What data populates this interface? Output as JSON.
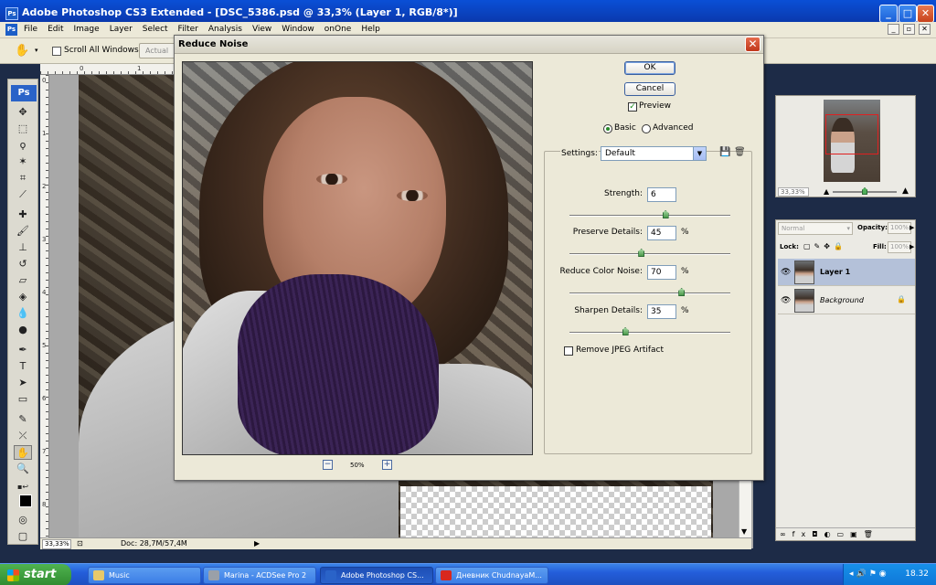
{
  "window": {
    "title": "Adobe Photoshop CS3 Extended - [DSC_5386.psd @ 33,3% (Layer 1, RGB/8*)]",
    "app_icon": "Ps"
  },
  "menu": {
    "items": [
      "File",
      "Edit",
      "Image",
      "Layer",
      "Select",
      "Filter",
      "Analysis",
      "View",
      "Window",
      "onOne",
      "Help"
    ]
  },
  "options_bar": {
    "scroll_all_windows": "Scroll All Windows",
    "actual_button": "Actual"
  },
  "toolbox": {
    "logo": "Ps"
  },
  "rulers": {
    "h_labels": [
      "0",
      "1"
    ],
    "v_labels": [
      "0",
      "1",
      "2",
      "3",
      "4",
      "5",
      "6",
      "7",
      "8"
    ]
  },
  "document": {
    "zoom": "33,33%",
    "doc_size": "Doc: 28,7M/57,4M"
  },
  "navigator": {
    "zoom": "33,33%"
  },
  "layers": {
    "blend_mode": "Normal",
    "opacity_label": "Opacity:",
    "opacity_value": "100%",
    "lock_label": "Lock:",
    "fill_label": "Fill:",
    "fill_value": "100%",
    "items": [
      {
        "name": "Layer 1",
        "selected": true
      },
      {
        "name": "Background",
        "selected": false
      }
    ]
  },
  "dialog": {
    "title": "Reduce Noise",
    "ok": "OK",
    "cancel": "Cancel",
    "preview_label": "Preview",
    "preview_checked": true,
    "mode_basic": "Basic",
    "mode_advanced": "Advanced",
    "mode_selected": "Basic",
    "settings_label": "Settings:",
    "settings_value": "Default",
    "preview_zoom": "50%",
    "sliders": [
      {
        "label": "Strength:",
        "value": "6",
        "unit": "",
        "fraction": 0.6
      },
      {
        "label": "Preserve Details:",
        "value": "45",
        "unit": "%",
        "fraction": 0.45
      },
      {
        "label": "Reduce Color Noise:",
        "value": "70",
        "unit": "%",
        "fraction": 0.7
      },
      {
        "label": "Sharpen Details:",
        "value": "35",
        "unit": "%",
        "fraction": 0.35
      }
    ],
    "remove_jpeg_label": "Remove JPEG Artifact",
    "remove_jpeg_checked": false
  },
  "taskbar": {
    "start": "start",
    "tasks": [
      {
        "label": "Music",
        "active": false,
        "icon_color": "#e8c96a"
      },
      {
        "label": "Marina - ACDSee Pro 2",
        "active": false,
        "icon_color": "#9aa0a8"
      },
      {
        "label": "Adobe Photoshop CS...",
        "active": true,
        "icon_color": "#2a63c8"
      },
      {
        "label": "Дневник ChudnayaM...",
        "active": false,
        "icon_color": "#d8281e"
      }
    ],
    "clock": "18.32"
  }
}
